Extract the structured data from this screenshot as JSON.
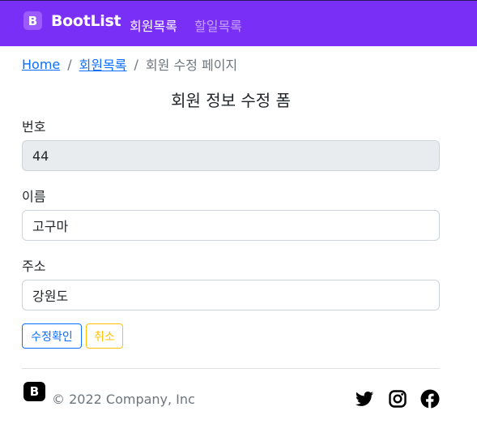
{
  "navbar": {
    "brand_logo": "B",
    "brand_name": "BootList",
    "links": [
      {
        "label": "회원목록",
        "active": true
      },
      {
        "label": "할일목록",
        "active": false
      }
    ],
    "color": "#7a2ff7"
  },
  "breadcrumb": {
    "home": "Home",
    "sep1": "/",
    "members": "회원목록",
    "sep2": "/",
    "current": "회원 수정 페이지"
  },
  "form": {
    "title": "회원 정보 수정 폼",
    "fields": [
      {
        "label": "번호",
        "value": "44",
        "disabled": true
      },
      {
        "label": "이름",
        "value": "고구마",
        "disabled": false
      },
      {
        "label": "주소",
        "value": "강원도",
        "disabled": false
      }
    ],
    "submit_label": "수정확인",
    "cancel_label": "취소"
  },
  "footer": {
    "logo": "B",
    "copyright": "© 2022 Company, Inc",
    "social_icons": [
      "twitter-icon",
      "instagram-icon",
      "facebook-icon"
    ]
  }
}
